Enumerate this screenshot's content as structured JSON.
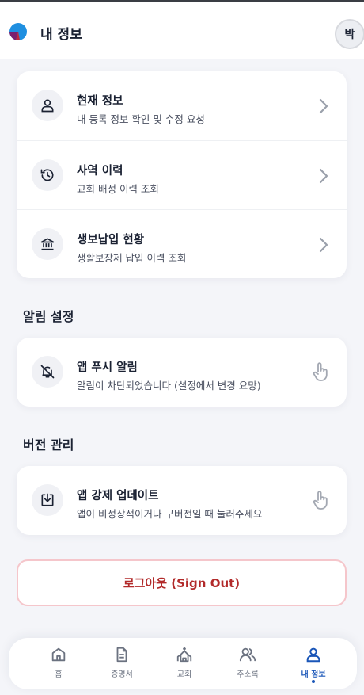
{
  "header": {
    "title": "내 정보",
    "avatar_initial": "박"
  },
  "info_card": {
    "items": [
      {
        "title": "현재 정보",
        "subtitle": "내 등록 정보 확인 및 수정 요청",
        "icon": "person-icon"
      },
      {
        "title": "사역 이력",
        "subtitle": "교회 배정 이력 조회",
        "icon": "history-icon"
      },
      {
        "title": "생보납입 현황",
        "subtitle": "생활보장제 납입 이력 조회",
        "icon": "bank-icon"
      }
    ]
  },
  "notification_section": {
    "title": "알림 설정",
    "item": {
      "title": "앱 푸시 알림",
      "subtitle": "알림이 차단되었습니다 (설정에서 변경 요망)",
      "icon": "bell-off-icon"
    }
  },
  "version_section": {
    "title": "버전 관리",
    "item": {
      "title": "앱 강제 업데이트",
      "subtitle": "앱이 비정상적이거나 구버전일 때 눌러주세요",
      "icon": "download-icon"
    }
  },
  "logout": {
    "label": "로그아웃 (Sign Out)",
    "color": "#b22a2a"
  },
  "bottom_nav": {
    "active_index": 4,
    "accent": "#1a56b8",
    "items": [
      {
        "label": "홈",
        "icon": "home-icon"
      },
      {
        "label": "증명서",
        "icon": "document-icon"
      },
      {
        "label": "교회",
        "icon": "church-icon"
      },
      {
        "label": "주소록",
        "icon": "contacts-icon"
      },
      {
        "label": "내 정보",
        "icon": "person-icon"
      }
    ]
  }
}
